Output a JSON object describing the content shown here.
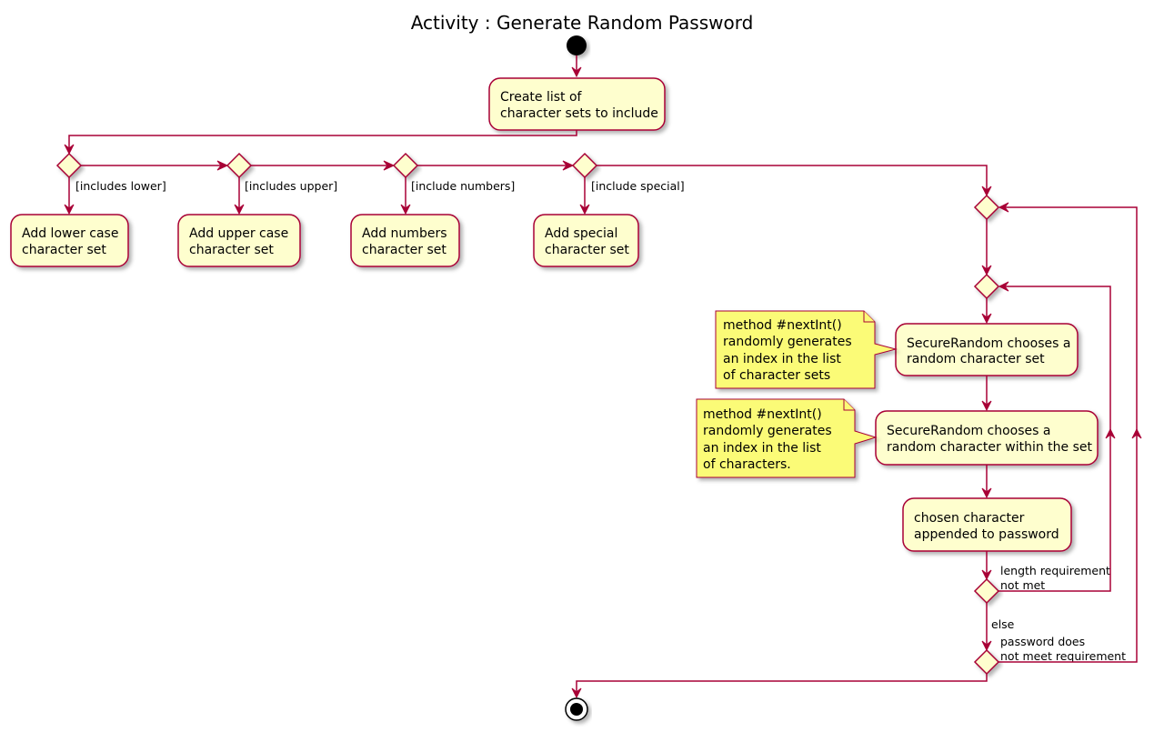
{
  "title": "Activity : Generate Random Password",
  "colors": {
    "border": "#A80036",
    "activity_fill": "#FEFECE",
    "note_fill": "#FBFB77"
  },
  "nodes": {
    "create_list": [
      "Create list of",
      "character sets to include"
    ],
    "add_lower": [
      "Add lower case",
      "character set"
    ],
    "add_upper": [
      "Add upper case",
      "character set"
    ],
    "add_numbers": [
      "Add numbers",
      "character set"
    ],
    "add_special": [
      "Add special",
      "character set"
    ],
    "choose_set": [
      "SecureRandom chooses a",
      "random character set"
    ],
    "choose_char": [
      "SecureRandom chooses a",
      "random character within the set"
    ],
    "append": [
      "chosen character",
      "appended to password"
    ]
  },
  "guards": {
    "lower": "[includes lower]",
    "upper": "[includes upper]",
    "numbers": "[include numbers]",
    "special": "[include special]",
    "length": [
      "length requirement",
      "not met"
    ],
    "else": "else",
    "requirement": [
      "password does",
      "not meet requirement"
    ]
  },
  "notes": {
    "note1": [
      "method #nextInt()",
      "randomly generates",
      "an index in the list",
      "of character sets"
    ],
    "note2": [
      "method #nextInt()",
      "randomly generates",
      "an index in the list",
      "of characters."
    ]
  }
}
